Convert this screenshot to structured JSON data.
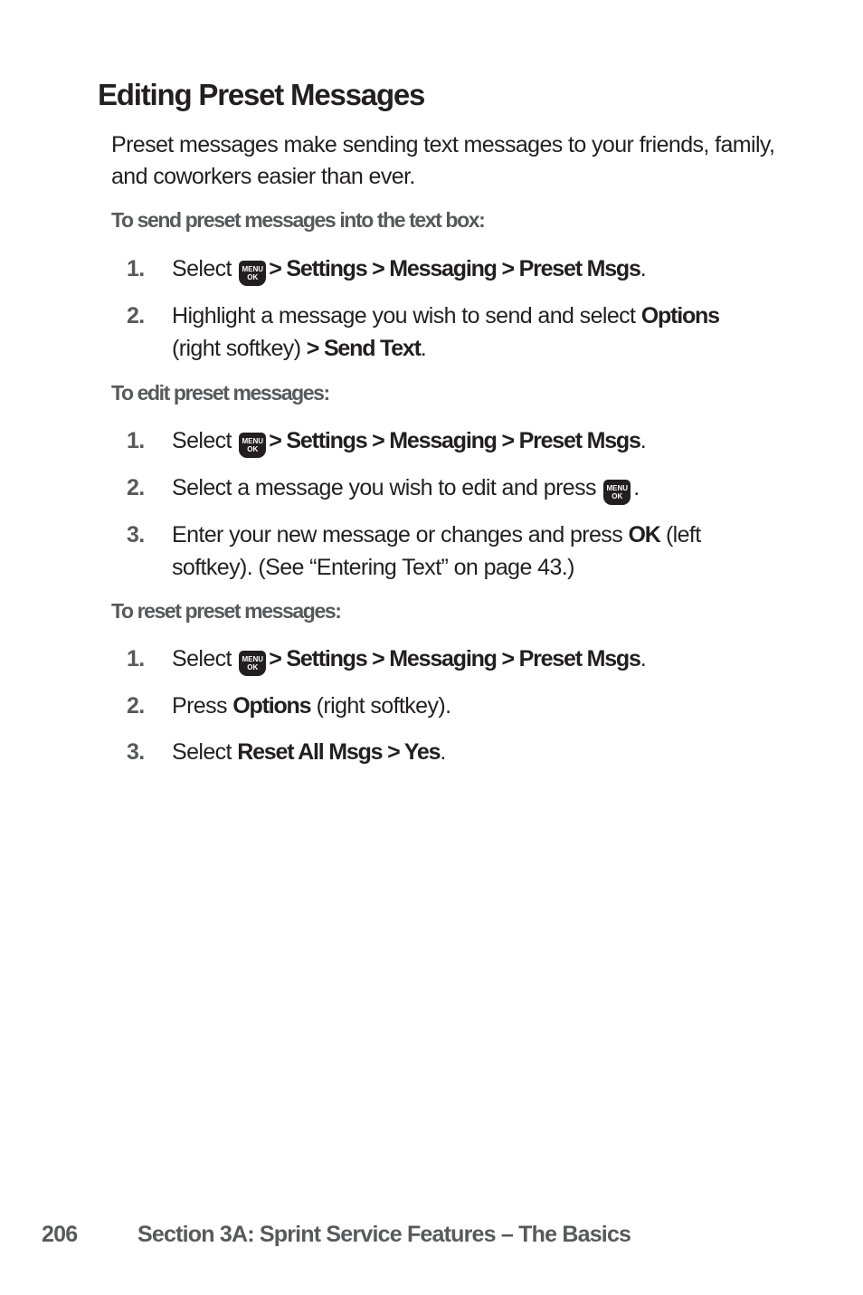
{
  "page": {
    "title": "Editing Preset Messages",
    "intro": "Preset messages make sending text messages to your friends, family, and coworkers easier than ever.",
    "icons": {
      "menu_key": {
        "name": "menu-ok-key-icon",
        "line1": "MENU",
        "line2": "OK"
      }
    },
    "sections": [
      {
        "heading": "To send preset messages into the text box:",
        "steps": [
          {
            "num": "1.",
            "pre": "Select",
            "icon": true,
            "bold": "> Settings > Messaging > Preset Msgs",
            "post": "."
          },
          {
            "num": "2.",
            "pre": "Highlight a message you wish to send and select",
            "bold": "Options",
            "post": "(right softkey)",
            "bold2": "> Send Text",
            "post2": "."
          }
        ]
      },
      {
        "heading": "To edit preset messages:",
        "steps": [
          {
            "num": "1.",
            "pre": "Select",
            "icon": true,
            "bold": "> Settings > Messaging > Preset Msgs",
            "post": "."
          },
          {
            "num": "2.",
            "pre": "Select a message you wish to edit and press",
            "icon": true,
            "post": "."
          },
          {
            "num": "3.",
            "pre": "Enter your new message or changes and press",
            "bold": "OK",
            "post": "(left softkey). (See “Entering Text” on page 43.)"
          }
        ]
      },
      {
        "heading": "To reset preset messages:",
        "steps": [
          {
            "num": "1.",
            "pre": "Select",
            "icon": true,
            "bold": "> Settings > Messaging > Preset Msgs",
            "post": "."
          },
          {
            "num": "2.",
            "pre": "Press",
            "bold": "Options",
            "post": "(right softkey)."
          },
          {
            "num": "3.",
            "pre": "Select",
            "bold": "Reset All Msgs > Yes",
            "post": "."
          }
        ]
      }
    ]
  },
  "footer": {
    "page_number": "206",
    "section_title": "Section 3A: Sprint Service Features – The Basics"
  }
}
